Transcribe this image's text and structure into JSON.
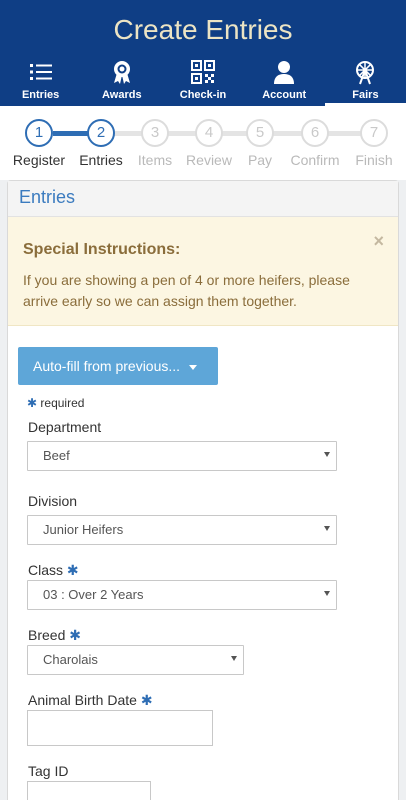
{
  "header": {
    "title": "Create Entries"
  },
  "nav": [
    {
      "label": "Entries",
      "icon": "list-icon"
    },
    {
      "label": "Awards",
      "icon": "award-ribbon-icon"
    },
    {
      "label": "Check-in",
      "icon": "qr-code-icon"
    },
    {
      "label": "Account",
      "icon": "user-icon"
    },
    {
      "label": "Fairs",
      "icon": "ferris-wheel-icon"
    }
  ],
  "stepper": {
    "steps": [
      {
        "number": "1",
        "label": "Register",
        "state": "done"
      },
      {
        "number": "2",
        "label": "Entries",
        "state": "current"
      },
      {
        "number": "3",
        "label": "Items",
        "state": "todo"
      },
      {
        "number": "4",
        "label": "Review",
        "state": "todo"
      },
      {
        "number": "5",
        "label": "Pay",
        "state": "todo"
      },
      {
        "number": "6",
        "label": "Confirm",
        "state": "todo"
      },
      {
        "number": "7",
        "label": "Finish",
        "state": "todo"
      }
    ]
  },
  "panel": {
    "title": "Entries"
  },
  "alert": {
    "title": "Special Instructions:",
    "body": "If you are showing a pen of 4 or more heifers, please arrive early so we can assign them together.",
    "close": "×"
  },
  "autofill": {
    "label": "Auto-fill from previous..."
  },
  "form": {
    "required_star": "✱",
    "required_note": "required",
    "department": {
      "label": "Department",
      "value": "Beef"
    },
    "division": {
      "label": "Division",
      "value": "Junior Heifers"
    },
    "class": {
      "label": "Class",
      "value": "03 : Over 2 Years"
    },
    "breed": {
      "label": "Breed",
      "value": "Charolais"
    },
    "birth_date": {
      "label": "Animal Birth Date",
      "value": ""
    },
    "tag_id": {
      "label": "Tag ID",
      "value": ""
    }
  },
  "colors": {
    "header": "#0f3e85",
    "title": "#ece4c4",
    "accent": "#2e6db4",
    "button": "#5ea6d8",
    "alert_bg": "#fcf6e2",
    "alert_text": "#8a6d3b"
  }
}
